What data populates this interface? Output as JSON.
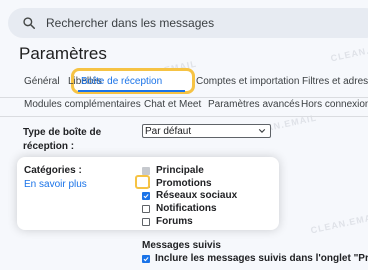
{
  "search": {
    "placeholder": "Rechercher dans les messages",
    "icon": "search-icon"
  },
  "page": {
    "title": "Paramètres"
  },
  "tabs": [
    {
      "label": "Général",
      "active": false
    },
    {
      "label": "Libellés",
      "active": false
    },
    {
      "label": "Boîte de réception",
      "active": true
    },
    {
      "label": "Comptes et importation",
      "active": false
    },
    {
      "label": "Filtres et adresses",
      "active": false
    }
  ],
  "subtabs": [
    {
      "label": "Modules complémentaires"
    },
    {
      "label": "Chat et Meet"
    },
    {
      "label": "Paramètres avancés"
    },
    {
      "label": "Hors connexion"
    }
  ],
  "inbox_type": {
    "label": "Type de boîte de réception :",
    "selected": "Par défaut"
  },
  "categories": {
    "title": "Catégories :",
    "learn_more": "En savoir plus",
    "items": [
      {
        "label": "Principale",
        "state": "disabled"
      },
      {
        "label": "Promotions",
        "state": "unchecked"
      },
      {
        "label": "Réseaux sociaux",
        "state": "checked"
      },
      {
        "label": "Notifications",
        "state": "unchecked"
      },
      {
        "label": "Forums",
        "state": "unchecked"
      }
    ]
  },
  "conversation": {
    "title": "Messages suivis",
    "option": "Inclure les messages suivis dans l'onglet \"Principale\""
  },
  "watermark": "CLEAN.EMAIL",
  "colors": {
    "accent": "#1a73e8",
    "highlight": "#f6c344"
  }
}
